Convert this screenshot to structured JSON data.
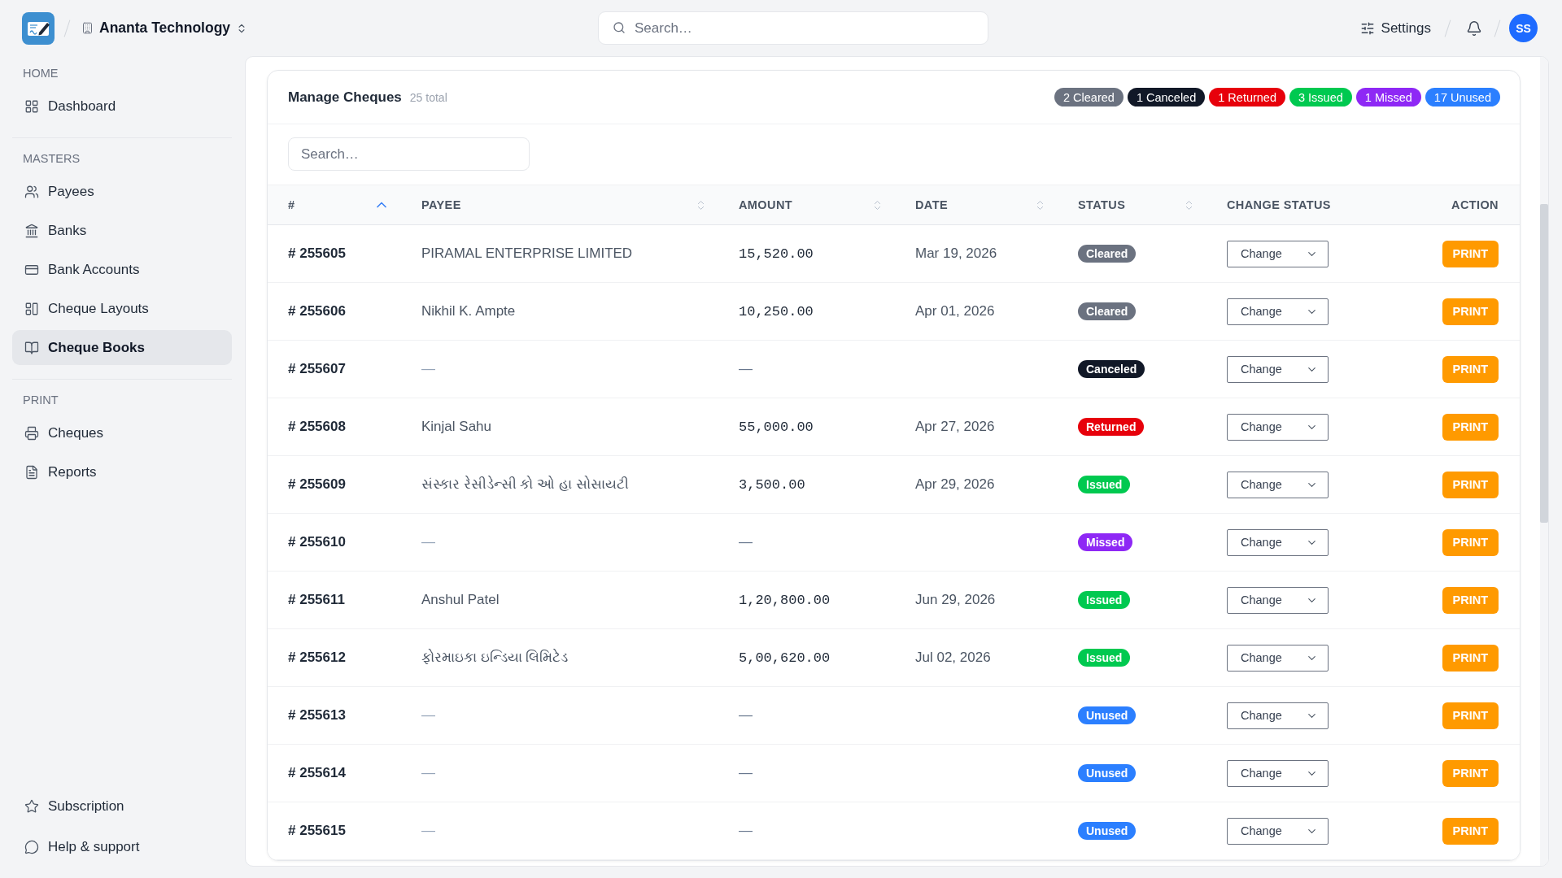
{
  "topbar": {
    "company": "Ananta Technology",
    "search": {
      "placeholder": "Search…"
    },
    "settings": "Settings",
    "avatar": "SS"
  },
  "sidebar": {
    "sections": [
      {
        "title": "HOME",
        "items": [
          {
            "label": "Dashboard",
            "selected": false
          }
        ]
      },
      {
        "title": "MASTERS",
        "items": [
          {
            "label": "Payees",
            "selected": false
          },
          {
            "label": "Banks",
            "selected": false
          },
          {
            "label": "Bank Accounts",
            "selected": false
          },
          {
            "label": "Cheque Layouts",
            "selected": false
          },
          {
            "label": "Cheque Books",
            "selected": true
          }
        ]
      },
      {
        "title": "PRINT",
        "items": [
          {
            "label": "Cheques",
            "selected": false
          },
          {
            "label": "Reports",
            "selected": false
          }
        ]
      }
    ],
    "footer_items": [
      {
        "label": "Subscription",
        "selected": false
      },
      {
        "label": "Help & support",
        "selected": false
      }
    ]
  },
  "card": {
    "title": "Manage Cheques",
    "count": "25 total",
    "summary": [
      {
        "label": "2 Cleared",
        "color": "#6b7280"
      },
      {
        "label": "1 Canceled",
        "color": "#111827"
      },
      {
        "label": "1 Returned",
        "color": "#e7000b"
      },
      {
        "label": "3 Issued",
        "color": "#00c950"
      },
      {
        "label": "1 Missed",
        "color": "#8e28f5"
      },
      {
        "label": "17 Unused",
        "color": "#2b7fff"
      }
    ],
    "search": {
      "placeholder": "Search…"
    },
    "table": {
      "columns": [
        {
          "label": "#",
          "sortable": true,
          "sorted": true
        },
        {
          "label": "PAYEE",
          "sortable": true,
          "sorted": false
        },
        {
          "label": "AMOUNT",
          "sortable": true,
          "sorted": false
        },
        {
          "label": "DATE",
          "sortable": true,
          "sorted": false
        },
        {
          "label": "STATUS",
          "sortable": true,
          "sorted": false
        },
        {
          "label": "CHANGE STATUS",
          "sortable": false,
          "sorted": false
        },
        {
          "label": "ACTION",
          "sortable": false,
          "sorted": false
        }
      ],
      "rows": [
        {
          "number": "# 255605",
          "payee": "PIRAMAL ENTERPRISE LIMITED",
          "amount": "15,520.00",
          "date": "Mar 19, 2026",
          "blank": false,
          "status": {
            "label": "Cleared",
            "color": "#6b7280"
          },
          "change": "Change",
          "action": "PRINT"
        },
        {
          "number": "# 255606",
          "payee": "Nikhil K. Ampte",
          "amount": "10,250.00",
          "date": "Apr 01, 2026",
          "blank": false,
          "status": {
            "label": "Cleared",
            "color": "#6b7280"
          },
          "change": "Change",
          "action": "PRINT"
        },
        {
          "number": "# 255607",
          "payee": "—",
          "amount": "—",
          "blank": true,
          "status": {
            "label": "Canceled",
            "color": "#111827"
          },
          "change": "Change",
          "action": "PRINT"
        },
        {
          "number": "# 255608",
          "payee": "Kinjal Sahu",
          "amount": "55,000.00",
          "date": "Apr 27, 2026",
          "blank": false,
          "status": {
            "label": "Returned",
            "color": "#e7000b"
          },
          "change": "Change",
          "action": "PRINT"
        },
        {
          "number": "# 255609",
          "payee": "સંસ્કાર રેસીડેન્સી કો ઓ હા સોસાયટી",
          "amount": "3,500.00",
          "date": "Apr 29, 2026",
          "blank": false,
          "status": {
            "label": "Issued",
            "color": "#00c950"
          },
          "change": "Change",
          "action": "PRINT"
        },
        {
          "number": "# 255610",
          "payee": "—",
          "amount": "—",
          "blank": true,
          "status": {
            "label": "Missed",
            "color": "#8e28f5"
          },
          "change": "Change",
          "action": "PRINT"
        },
        {
          "number": "# 255611",
          "payee": "Anshul Patel",
          "amount": "1,20,800.00",
          "date": "Jun 29, 2026",
          "blank": false,
          "status": {
            "label": "Issued",
            "color": "#00c950"
          },
          "change": "Change",
          "action": "PRINT"
        },
        {
          "number": "# 255612",
          "payee": "ફોરમાઇકા ઇન્ડિયા લિમિટેડ",
          "amount": "5,00,620.00",
          "date": "Jul 02, 2026",
          "blank": false,
          "status": {
            "label": "Issued",
            "color": "#00c950"
          },
          "change": "Change",
          "action": "PRINT"
        },
        {
          "number": "# 255613",
          "payee": "—",
          "amount": "—",
          "blank": true,
          "status": {
            "label": "Unused",
            "color": "#2b7fff"
          },
          "change": "Change",
          "action": "PRINT"
        },
        {
          "number": "# 255614",
          "payee": "—",
          "amount": "—",
          "blank": true,
          "status": {
            "label": "Unused",
            "color": "#2b7fff"
          },
          "change": "Change",
          "action": "PRINT"
        },
        {
          "number": "# 255615",
          "payee": "—",
          "amount": "—",
          "blank": true,
          "status": {
            "label": "Unused",
            "color": "#2b7fff"
          },
          "change": "Change",
          "action": "PRINT"
        }
      ]
    }
  }
}
